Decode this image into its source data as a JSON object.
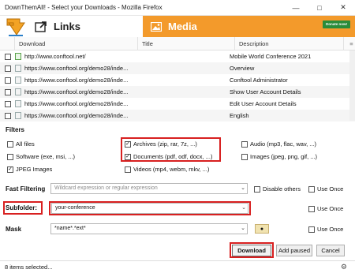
{
  "window": {
    "title": "DownThemAll! - Select your Downloads - Mozilla Firefox"
  },
  "tabs": {
    "links": "Links",
    "media": "Media",
    "donate": "Donate now!"
  },
  "table": {
    "columns": [
      "Download",
      "Title",
      "Description"
    ],
    "rows": [
      {
        "url": "http://www.conftool.net/",
        "title": "",
        "desc": "Mobile World Conference 2021",
        "icon": "page-green"
      },
      {
        "url": "https://www.conftool.org/demo28/inde...",
        "title": "",
        "desc": "Overview",
        "icon": "page"
      },
      {
        "url": "https://www.conftool.org/demo28/inde...",
        "title": "",
        "desc": "Conftool Administrator",
        "icon": "page"
      },
      {
        "url": "https://www.conftool.org/demo28/inde...",
        "title": "",
        "desc": "Show User Account Details",
        "icon": "page"
      },
      {
        "url": "https://www.conftool.org/demo28/inde...",
        "title": "",
        "desc": "Edit User Account Details",
        "icon": "page"
      },
      {
        "url": "https://www.conftool.org/demo28/inde...",
        "title": "",
        "desc": "English",
        "icon": "page"
      }
    ]
  },
  "filters": {
    "label": "Filters",
    "all_files": "All files",
    "software": "Software (exe, msi, ...)",
    "jpeg": "JPEG Images",
    "archives": "Archives (zip, rar, 7z, ...)",
    "documents": "Documents (pdf, odf, docx, ...)",
    "videos": "Videos (mp4, webm, mkv, ...)",
    "audio": "Audio (mp3, flac, wav, ...)",
    "images": "Images (jpeg, png, gif, ...)"
  },
  "fast_filtering": {
    "label": "Fast Filtering",
    "placeholder": "Wildcard expression or regular expression",
    "disable_others": "Disable others",
    "use_once": "Use Once"
  },
  "subfolder": {
    "label": "Subfolder:",
    "value": "your-conference",
    "use_once": "Use Once"
  },
  "mask": {
    "label": "Mask",
    "value": "*name*.*ext*",
    "use_once": "Use Once"
  },
  "buttons": {
    "download": "Download",
    "add_paused": "Add paused",
    "cancel": "Cancel"
  },
  "status": "8 items selected...",
  "colors": {
    "media_tab": "#f39a2b",
    "highlight": "#d82020",
    "donate": "#2a8c3a"
  }
}
